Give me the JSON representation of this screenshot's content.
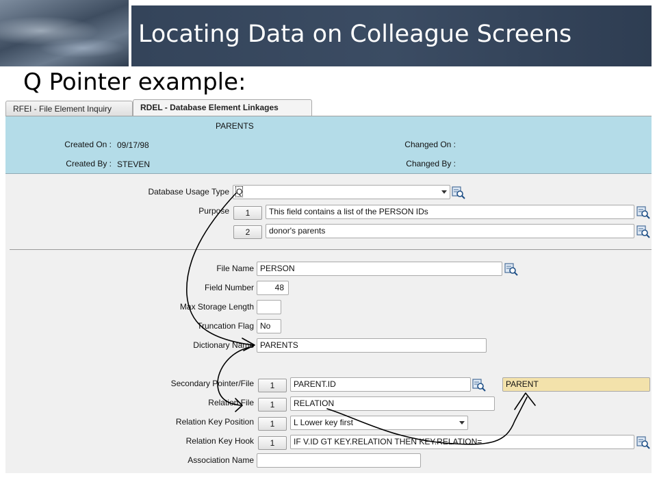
{
  "slide": {
    "title": "Locating Data on Colleague Screens",
    "subtitle": "Q Pointer example:"
  },
  "tabs": [
    {
      "label": "RFEI - File Element Inquiry",
      "active": false
    },
    {
      "label": "RDEL - Database Element Linkages",
      "active": true
    }
  ],
  "header": {
    "element_name": "PARENTS",
    "created_on_label": "Created On :",
    "created_on_value": "09/17/98",
    "created_by_label": "Created By :",
    "created_by_value": "STEVEN",
    "changed_on_label": "Changed On :",
    "changed_by_label": "Changed By :"
  },
  "fields": {
    "usage_type": {
      "label": "Database Usage Type",
      "value": "Q"
    },
    "purpose": {
      "label": "Purpose",
      "rows": [
        {
          "index": "1",
          "value": "This field contains a list of the PERSON IDs"
        },
        {
          "index": "2",
          "value": "donor's parents"
        }
      ]
    },
    "file_name": {
      "label": "File Name",
      "value": "PERSON"
    },
    "field_number": {
      "label": "Field Number",
      "value": "48"
    },
    "max_storage_length": {
      "label": "Max Storage Length",
      "value": ""
    },
    "truncation_flag": {
      "label": "Truncation Flag",
      "value": "No"
    },
    "dictionary_name": {
      "label": "Dictionary Name",
      "value": "PARENTS"
    },
    "secondary_pointer": {
      "label": "Secondary Pointer/File",
      "index": "1",
      "value": "PARENT.ID",
      "file": "PARENT"
    },
    "relation_file": {
      "label": "Relation File",
      "index": "1",
      "value": "RELATION"
    },
    "relation_key_position": {
      "label": "Relation Key Position",
      "index": "1",
      "value": "L Lower key first"
    },
    "relation_key_hook": {
      "label": "Relation Key Hook",
      "index": "1",
      "value": "IF V.ID GT KEY.RELATION THEN KEY.RELATION="
    },
    "association_name": {
      "label": "Association Name",
      "value": ""
    }
  },
  "colors": {
    "header_panel": "#b4dce8",
    "title_bar": "#34445a",
    "highlight_field": "#f3e2ab"
  },
  "icons": [
    "lookup-icon",
    "dropdown-arrow-icon"
  ]
}
